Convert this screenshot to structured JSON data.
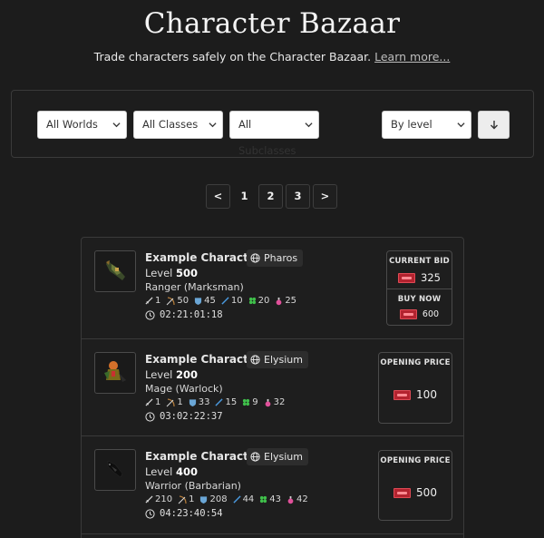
{
  "header": {
    "title": "Character Bazaar",
    "subtitle": "Trade characters safely on the Character Bazaar.",
    "learn_more": "Learn more..."
  },
  "filters": {
    "world": "All Worlds",
    "class": "All Classes",
    "subclass": "All Subclasses",
    "sort": "By level"
  },
  "pagination": {
    "prev": "<",
    "pages": [
      "1",
      "2",
      "3"
    ],
    "current": "1",
    "next": ">"
  },
  "listings": [
    {
      "name": "Example Character",
      "world": "Pharos",
      "level_label": "Level",
      "level": "500",
      "vocation": "Ranger (Marksman)",
      "skills": [
        "1",
        "50",
        "45",
        "10",
        "20",
        "25"
      ],
      "time_left": "02:21:01:18",
      "price_type": "bid",
      "current_bid_label": "CURRENT BID",
      "current_bid": "325",
      "buy_now_label": "BUY NOW",
      "buy_now": "600"
    },
    {
      "name": "Example Character",
      "world": "Elysium",
      "level_label": "Level",
      "level": "200",
      "vocation": "Mage (Warlock)",
      "skills": [
        "1",
        "1",
        "33",
        "15",
        "9",
        "32"
      ],
      "time_left": "03:02:22:37",
      "price_type": "opening",
      "opening_label": "OPENING PRICE",
      "opening_price": "100"
    },
    {
      "name": "Example Character",
      "world": "Elysium",
      "level_label": "Level",
      "level": "400",
      "vocation": "Warrior (Barbarian)",
      "skills": [
        "210",
        "1",
        "208",
        "44",
        "43",
        "42"
      ],
      "time_left": "04:23:40:54",
      "price_type": "opening",
      "opening_label": "OPENING PRICE",
      "opening_price": "500"
    }
  ],
  "icons": {
    "skills": [
      "sword-icon",
      "bow-icon",
      "shield-icon",
      "wand-icon",
      "clover-icon",
      "potion-icon"
    ],
    "world": "globe-icon",
    "timer": "clock-icon",
    "currency": "coin-icon"
  },
  "colors": {
    "background": "#1c1c1c",
    "coin": "#b3232f"
  }
}
